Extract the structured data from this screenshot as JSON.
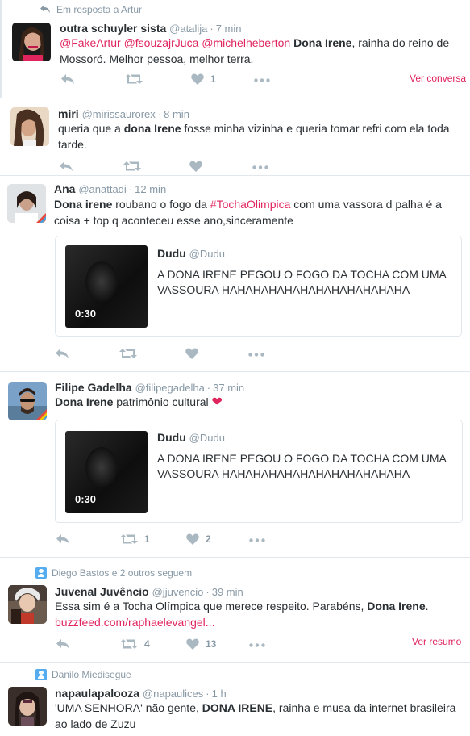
{
  "tweets": [
    {
      "context": "Em resposta a Artur",
      "name": "outra schuyler sista",
      "handle": "@atalija",
      "time": "7 min",
      "text_parts": [
        "@FakeArtur",
        " ",
        "@fsouzajrJuca",
        " ",
        "@michelheberton",
        " ",
        "Dona Irene",
        ", rainha do reino de Mossoró. Melhor pessoa, melhor terra."
      ],
      "likes": "1",
      "more_link": "Ver conversa"
    },
    {
      "name": "miri",
      "handle": "@mirissaurorex",
      "time": "8 min",
      "text_parts": [
        "queria que a ",
        "dona Irene",
        " fosse minha vizinha e queria tomar refri com ela toda tarde."
      ]
    },
    {
      "name": "Ana",
      "handle": "@anattadi",
      "time": "12 min",
      "text_parts": [
        "Dona irene",
        " roubano o fogo da ",
        "#TochaOlimpica",
        " com uma vassora d palha é a coisa + top q aconteceu esse ano,sinceramente"
      ],
      "quote": {
        "name": "Dudu",
        "handle": "@Dudu",
        "text": "A DONA IRENE PEGOU O FOGO DA TOCHA COM UMA VASSOURA HAHAHAHAHAHAHAHAHAHAHAHA",
        "duration": "0:30"
      }
    },
    {
      "name": "Filipe Gadelha",
      "handle": "@filipegadelha",
      "time": "37 min",
      "text_parts": [
        "Dona Irene",
        " patrimônio cultural "
      ],
      "heart_emoji": "❤",
      "quote": {
        "name": "Dudu",
        "handle": "@Dudu",
        "text": "A DONA IRENE PEGOU O FOGO DA TOCHA COM UMA VASSOURA HAHAHAHAHAHAHAHAHAHAHAHA",
        "duration": "0:30"
      },
      "retweets": "1",
      "likes": "2"
    },
    {
      "context": "Diego Bastos e 2 outros seguem",
      "name": "Juvenal Juvêncio",
      "handle": "@jjuvencio",
      "time": "39 min",
      "text_parts": [
        "Essa sim é a Tocha Olímpica que merece respeito. Parabéns, ",
        "Dona Irene",
        "."
      ],
      "link": "buzzfeed.com/raphaelevangel...",
      "retweets": "4",
      "likes": "13",
      "more_link": "Ver resumo"
    },
    {
      "context": "Danilo Miedisegue",
      "name": "napaulapalooza",
      "handle": "@napaulices",
      "time": "1 h",
      "text_parts": [
        "'UMA SENHORA' não gente, ",
        "DONA IRENE",
        ", rainha e musa da internet brasileira ao lado de Zuzu"
      ]
    }
  ],
  "icons": {
    "reply": "reply-icon",
    "retweet": "retweet-icon",
    "like": "heart-icon",
    "more": "more-icon",
    "context_reply": "reply-arrow-icon",
    "context_follow": "person-icon"
  },
  "colors": {
    "link": "#e0245e",
    "muted": "#8899a6",
    "action": "#aab8c2",
    "border": "#e1e8ed"
  }
}
